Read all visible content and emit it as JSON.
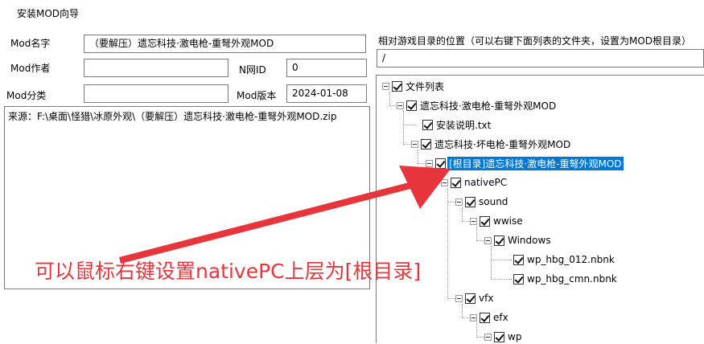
{
  "window": {
    "title": "安装MOD向导"
  },
  "form": {
    "mod_name_label": "Mod名字",
    "mod_name_value": "（要解压）遗忘科技·激电枪-重弩外观MOD",
    "mod_author_label": "Mod作者",
    "mod_author_value": "",
    "nexus_id_label": "N网ID",
    "nexus_id_value": "0",
    "mod_category_label": "Mod分类",
    "mod_category_value": "",
    "mod_version_label": "Mod版本",
    "mod_version_value": "2024-01-08",
    "source_text": "来源：F:\\桌面\\怪猎\\冰原外观\\（要解压）遗忘科技·激电枪-重弩外观MOD.zip"
  },
  "right": {
    "location_label": "相对游戏目录的位置（可以右键下面列表的文件夹，设置为MOD根目录）",
    "location_value": "/"
  },
  "tree": {
    "nodes": [
      {
        "label": "文件列表",
        "expanded": true,
        "checked": true
      },
      {
        "label": "遗忘科技·激电枪-重弩外观MOD",
        "expanded": true,
        "checked": true
      },
      {
        "label": "安装说明.txt",
        "checked": true
      },
      {
        "label": "遗忘科技·坏电枪-重弩外观MOD",
        "expanded": true,
        "checked": true
      },
      {
        "label": "[根目录]遗忘科技·激电枪-重弩外观MOD",
        "expanded": true,
        "checked": true,
        "selected": true
      },
      {
        "label": "nativePC",
        "expanded": true,
        "checked": true
      },
      {
        "label": "sound",
        "expanded": true,
        "checked": true
      },
      {
        "label": "wwise",
        "expanded": true,
        "checked": true
      },
      {
        "label": "Windows",
        "expanded": true,
        "checked": true
      },
      {
        "label": "wp_hbg_012.nbnk",
        "checked": true
      },
      {
        "label": "wp_hbg_cmn.nbnk",
        "checked": true
      },
      {
        "label": "vfx",
        "expanded": true,
        "checked": true
      },
      {
        "label": "efx",
        "expanded": true,
        "checked": true
      },
      {
        "label": "wp",
        "expanded": true,
        "checked": true
      }
    ]
  },
  "annotation": {
    "text": "可以鼠标右键设置nativePC上层为[根目录]",
    "color": "#e8353b"
  },
  "colors": {
    "selection": "#0078d7",
    "border": "#7a7a7a"
  }
}
